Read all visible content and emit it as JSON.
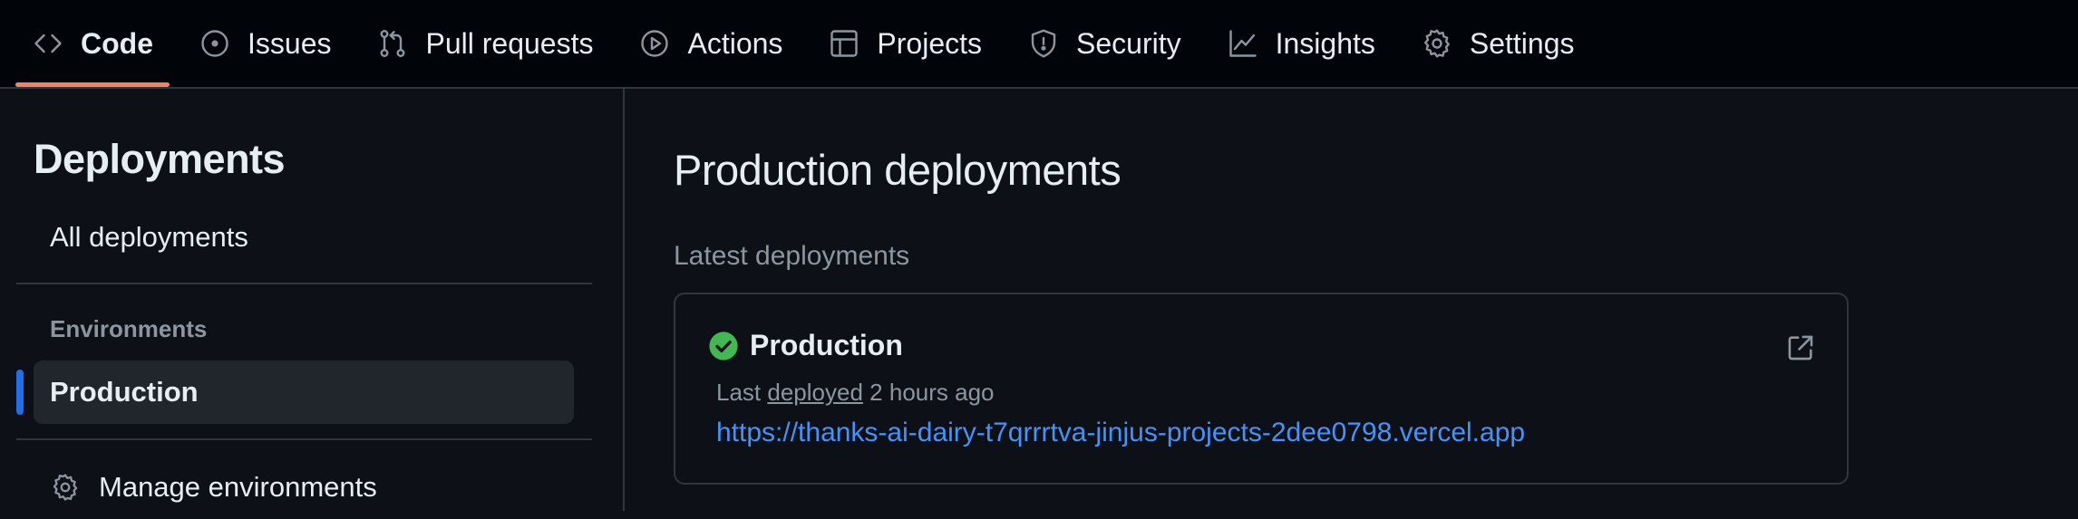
{
  "nav": {
    "tabs": [
      {
        "label": "Code",
        "icon": "code-icon",
        "active": true
      },
      {
        "label": "Issues",
        "icon": "issue-opened-icon"
      },
      {
        "label": "Pull requests",
        "icon": "git-pull-request-icon"
      },
      {
        "label": "Actions",
        "icon": "play-icon"
      },
      {
        "label": "Projects",
        "icon": "table-icon"
      },
      {
        "label": "Security",
        "icon": "shield-icon"
      },
      {
        "label": "Insights",
        "icon": "graph-icon"
      },
      {
        "label": "Settings",
        "icon": "gear-icon"
      }
    ],
    "active_color": "#f78166"
  },
  "sidebar": {
    "title": "Deployments",
    "all_label": "All deployments",
    "environments_heading": "Environments",
    "active_environment": "Production",
    "manage_label": "Manage environments",
    "accent_color": "#1f6feb"
  },
  "main": {
    "title": "Production deployments",
    "section_label": "Latest deployments",
    "card": {
      "environment": "Production",
      "status": "success",
      "status_color": "#3fb950",
      "meta_prefix": "Last",
      "meta_link": "deployed",
      "meta_suffix": "2 hours ago",
      "url": "https://thanks-ai-dairy-t7qrrrtva-jinjus-projects-2dee0798.vercel.app",
      "link_color": "#4493f8"
    }
  }
}
